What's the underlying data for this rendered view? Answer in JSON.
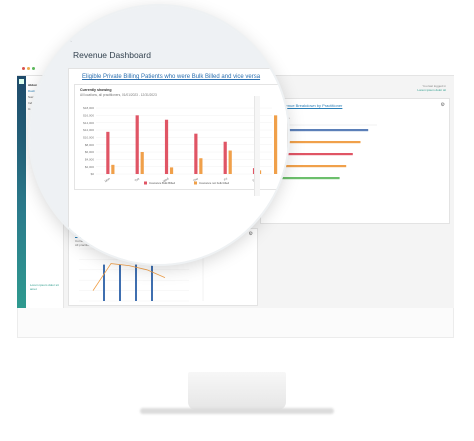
{
  "app": {
    "page_title": "Revenue Dashboard",
    "breadcrumb_caret": "‹",
    "top_right_text": "You last logged in",
    "top_right_link": "Lorem ipsum dolor sit"
  },
  "sidebar": {
    "group_label": "Abbot",
    "items": [
      "Dash",
      "Sum",
      "Ind",
      "Cal"
    ],
    "footer_text": "Lorem ipsum dolor sit amet"
  },
  "main_card": {
    "link": "Eligible Private Billing Patients who were Bulk Billed and vice versa",
    "status_label": "Currently showing",
    "filter_text": "All locations, all practitioners, 01/01/2023 - 12/31/2023"
  },
  "right_card": {
    "title": "Gain Revenue Breakdown by Practitioner",
    "meta_line1": "Gains Income",
    "meta_line2": "Quarter to Date"
  },
  "bottom_card": {
    "title": "Billing",
    "meta_line1": "Currently showing",
    "meta_line2": "All practitioners, all locations"
  },
  "icons": {
    "card_menu": "settings-icon",
    "caret": "chevron-left-icon"
  },
  "colors": {
    "series_a": "#e05565",
    "series_b": "#f0a04a",
    "accent": "#2a7fb8",
    "sidebar": "#2b7c8c"
  },
  "chart_data": [
    {
      "type": "bar",
      "categories": [
        "Mon",
        "Tue",
        "Wed",
        "Thu",
        "Fri",
        "Sat"
      ],
      "series": [
        {
          "name": "Insurance Bulk Billed",
          "values": [
            11500,
            16000,
            14800,
            11000,
            8800,
            1600
          ]
        },
        {
          "name": "Insurance not bulk billed",
          "values": [
            2500,
            6000,
            1800,
            4300,
            6400,
            1000
          ]
        }
      ],
      "extra_bar": {
        "series": "Insurance not bulk billed",
        "value": 16000
      },
      "y_ticks": [
        "$0",
        "$2,000",
        "$4,000",
        "$6,000",
        "$8,000",
        "$10,000",
        "$12,000",
        "$14,000",
        "$16,000",
        "$18,000"
      ],
      "ylim": [
        0,
        18000
      ]
    },
    {
      "type": "bar",
      "orientation": "horizontal",
      "series": [
        {
          "name": "Row 1",
          "values": [
            92
          ],
          "color": "#5b7fb8"
        },
        {
          "name": "Row 2",
          "values": [
            85
          ],
          "color": "#f0a04a"
        },
        {
          "name": "Row 3",
          "values": [
            78
          ],
          "color": "#e05565"
        },
        {
          "name": "Row 4",
          "values": [
            72
          ],
          "color": "#f0a04a"
        },
        {
          "name": "Row 5",
          "values": [
            66
          ],
          "color": "#6cbf6c"
        }
      ],
      "xlim": [
        0,
        100
      ]
    },
    {
      "type": "bar",
      "values": [
        70,
        70,
        70,
        70
      ],
      "line": [
        20,
        72,
        68,
        60,
        45
      ],
      "ylim": [
        0,
        100
      ]
    }
  ]
}
